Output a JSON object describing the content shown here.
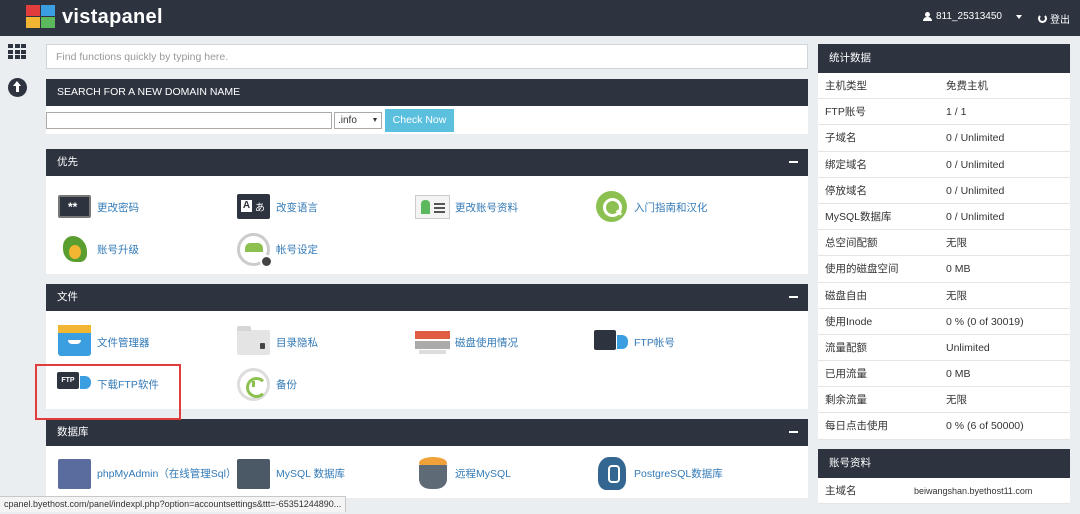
{
  "header": {
    "logo_text": "vistapanel",
    "username": "811_25313450",
    "logout_label": "登出"
  },
  "search": {
    "placeholder": "Find functions quickly by typing here."
  },
  "domain_search": {
    "title": "SEARCH FOR A NEW DOMAIN NAME",
    "input_value": "",
    "tld": ".info",
    "button_label": "Check Now"
  },
  "sections": [
    {
      "title": "优先",
      "items": [
        {
          "label": "更改密码",
          "icon": "password-icon"
        },
        {
          "label": "改变语言",
          "icon": "language-icon"
        },
        {
          "label": "更改账号资料",
          "icon": "contact-card-icon"
        },
        {
          "label": "入门指南和汉化",
          "icon": "getting-started-icon"
        },
        {
          "label": "账号升级",
          "icon": "upgrade-dragon-icon"
        },
        {
          "label": "帐号设定",
          "icon": "account-settings-icon"
        }
      ]
    },
    {
      "title": "文件",
      "items": [
        {
          "label": "文件管理器",
          "icon": "file-manager-icon"
        },
        {
          "label": "目录隐私",
          "icon": "folder-lock-icon"
        },
        {
          "label": "磁盘使用情况",
          "icon": "disk-usage-icon"
        },
        {
          "label": "FTP帐号",
          "icon": "ftp-account-icon"
        },
        {
          "label": "下载FTP软件",
          "icon": "ftp-software-icon"
        },
        {
          "label": "备份",
          "icon": "backup-icon"
        }
      ]
    },
    {
      "title": "数据库",
      "items": [
        {
          "label": "phpMyAdmin（在线管理Sql）",
          "icon": "phpmyadmin-icon"
        },
        {
          "label": "MySQL 数据库",
          "icon": "mysql-icon"
        },
        {
          "label": "远程MySQL",
          "icon": "remote-mysql-icon"
        },
        {
          "label": "PostgreSQL数据库",
          "icon": "postgresql-icon"
        }
      ]
    }
  ],
  "stats": {
    "title": "统计数据",
    "rows": [
      {
        "k": "主机类型",
        "v": "免费主机"
      },
      {
        "k": "FTP账号",
        "v": "1 / 1"
      },
      {
        "k": "子域名",
        "v": "0 / Unlimited"
      },
      {
        "k": "绑定域名",
        "v": "0 / Unlimited"
      },
      {
        "k": "停放域名",
        "v": "0 / Unlimited"
      },
      {
        "k": "MySQL数据库",
        "v": "0 / Unlimited"
      },
      {
        "k": "总空间配额",
        "v": "无限"
      },
      {
        "k": "使用的磁盘空间",
        "v": "0 MB"
      },
      {
        "k": "磁盘自由",
        "v": "无限"
      },
      {
        "k": "使用Inode",
        "v": "0 % (0 of 30019)"
      },
      {
        "k": "流量配额",
        "v": "Unlimited"
      },
      {
        "k": "已用流量",
        "v": "0 MB"
      },
      {
        "k": "剩余流量",
        "v": "无限"
      },
      {
        "k": "每日点击使用",
        "v": "0 % (6 of 50000)"
      }
    ]
  },
  "account": {
    "title": "账号资料",
    "rows": [
      {
        "k": "主域名",
        "v": "beiwangshan.byethost11.com"
      }
    ]
  },
  "statusbar": {
    "text": "cpanel.byethost.com/panel/indexpl.php?option=accountsettings&ttt=-65351244890..."
  },
  "colors": {
    "topbar": "#2d3440",
    "link": "#337ab7",
    "check_button": "#5bc0de",
    "highlight": "#e03c3c"
  }
}
